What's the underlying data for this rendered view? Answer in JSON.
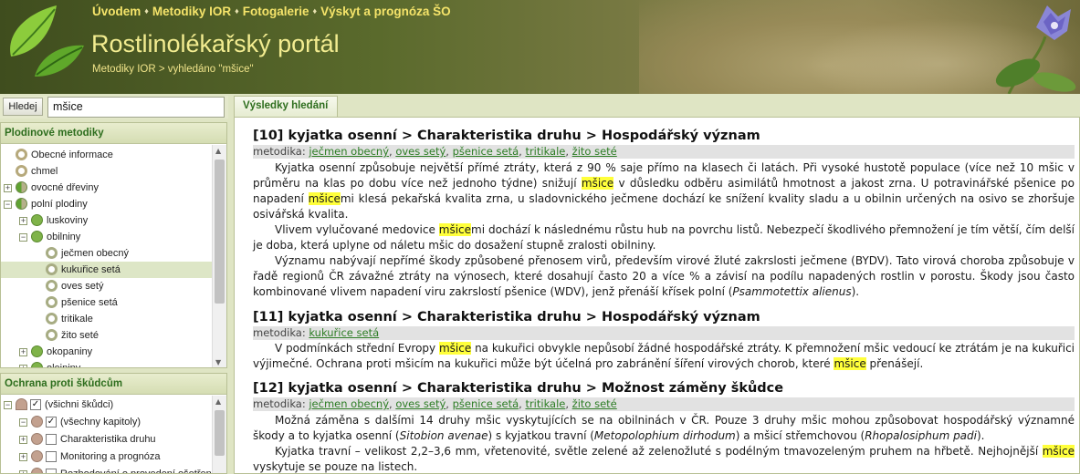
{
  "header": {
    "nav": [
      "Úvodem",
      "Metodiky IOR",
      "Fotogalerie",
      "Výskyt a prognóza ŠO"
    ],
    "title": "Rostlinolékařský portál",
    "breadcrumb": "Metodiky IOR > vyhledáno \"mšice\""
  },
  "search": {
    "button_label": "Hledej",
    "value": "mšice"
  },
  "left": {
    "panel1_title": "Plodinové metodiky",
    "tree1": [
      {
        "label": "Obecné informace"
      },
      {
        "label": "chmel"
      },
      {
        "label": "ovocné dřeviny"
      },
      {
        "label": "polní plodiny"
      },
      {
        "label": "luskoviny"
      },
      {
        "label": "obilniny"
      },
      {
        "label": "ječmen obecný"
      },
      {
        "label": "kukuřice setá"
      },
      {
        "label": "oves setý"
      },
      {
        "label": "pšenice setá"
      },
      {
        "label": "tritikale"
      },
      {
        "label": "žito seté"
      },
      {
        "label": "okopaniny"
      },
      {
        "label": "olejniny"
      }
    ],
    "panel2_title": "Ochrana proti škůdcům",
    "tree2": [
      {
        "label": "(všichni škůdci)"
      },
      {
        "label": "(všechny kapitoly)"
      },
      {
        "label": "Charakteristika druhu"
      },
      {
        "label": "Monitoring a prognóza"
      },
      {
        "label": "Rozhodování o provedení ošetření"
      }
    ]
  },
  "results": {
    "tab_label": "Výsledky hledání",
    "metodika_label": "metodika:",
    "items": [
      {
        "title": "[10] kyjatka osenní > Charakteristika druhu > Hospodářský význam",
        "crops": [
          "ječmen obecný",
          "oves setý",
          "pšenice setá",
          "tritikale",
          "žito seté"
        ],
        "paragraphs": [
          [
            "Kyjatka osenní způsobuje největší přímé ztráty, která z 90 % saje přímo na klasech či latách. Při vysoké hustotě populace (více než 10 mšic v průměru na klas po dobu více než jednoho týdne) snižují ",
            "mšice",
            " v důsledku odběru asimilátů hmotnost a jakost zrna. U potravinářské pšenice po napadení ",
            "mšice",
            "mi klesá pekařská kvalita zrna, u sladovnického ječmene dochází ke snížení kvality sladu a u obilnin určených na osivo se zhoršuje osivářská kvalita."
          ],
          [
            "Vlivem vylučované medovice ",
            "mšice",
            "mi dochází k následnému růstu hub na povrchu listů. Nebezpečí škodlivého přemnožení je tím větší, čím delší je doba, která uplyne od náletu mšic do dosažení stupně zralosti obilniny."
          ],
          [
            "Významu nabývají nepřímé škody způsobené přenosem virů, především virové žluté zakrslosti ječmene (BYDV). Tato virová choroba způsobuje v řadě regionů ČR závažné ztráty na výnosech, které dosahují často 20 a více % a závisí na podílu napadených rostlin v porostu. Škody jsou často kombinované vlivem napadení viru zakrslostí pšenice (WDV), jenž přenáší křísek polní (",
            "Psammotettix alienus",
            ")."
          ]
        ]
      },
      {
        "title": "[11] kyjatka osenní > Charakteristika druhu > Hospodářský význam",
        "crops": [
          "kukuřice setá"
        ],
        "paragraphs": [
          [
            "V podmínkách střední Evropy ",
            "mšice",
            " na kukuřici obvykle nepůsobí žádné hospodářské ztráty. K přemnožení mšic vedoucí ke ztrátám je na kukuřici výjimečné. Ochrana proti mšicím na kukuřici může být účelná pro zabránění šíření virových chorob, které ",
            "mšice",
            " přenášejí."
          ]
        ]
      },
      {
        "title": "[12] kyjatka osenní > Charakteristika druhu > Možnost záměny škůdce",
        "crops": [
          "ječmen obecný",
          "oves setý",
          "pšenice setá",
          "tritikale",
          "žito seté"
        ],
        "paragraphs": [
          [
            "Možná záměna s dalšími 14 druhy mšic vyskytujících se na obilninách v ČR. Pouze 3 druhy mšic mohou způsobovat hospodářský významné škody a to kyjatka osenní (",
            "Sitobion avenae",
            ") s kyjatkou travní (",
            "Metopolophium dirhodum",
            ") a mšicí střemchovou (",
            "Rhopalosiphum padi",
            ")."
          ],
          [
            "Kyjatka travní – velikost 2,2–3,6 mm, vřetenovité, světle zelené až zelenožluté s podélným tmavozeleným pruhem na hřbetě. Nejhojnější ",
            "mšice",
            " vyskytuje se pouze na listech."
          ]
        ]
      }
    ]
  }
}
